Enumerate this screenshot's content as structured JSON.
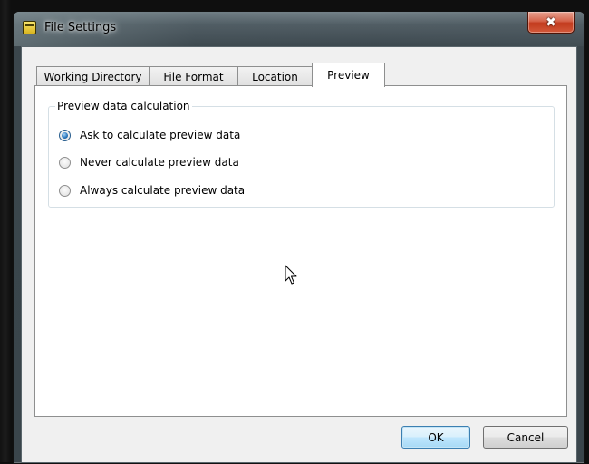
{
  "window": {
    "title": "File Settings",
    "close_glyph": "✖"
  },
  "tabs": [
    {
      "label": "Working Directory",
      "active": false
    },
    {
      "label": "File Format",
      "active": false
    },
    {
      "label": "Location",
      "active": false
    },
    {
      "label": "Preview",
      "active": true
    }
  ],
  "preview_group": {
    "legend": "Preview data calculation",
    "options": [
      {
        "label": "Ask to calculate preview data",
        "checked": true
      },
      {
        "label": "Never calculate preview data",
        "checked": false
      },
      {
        "label": "Always calculate preview data",
        "checked": false
      }
    ]
  },
  "buttons": {
    "ok_label": "OK",
    "cancel_label": "Cancel"
  },
  "colors": {
    "dialog_bg": "#f0f0f0",
    "panel_bg": "#ffffff",
    "selected_radio": "#2c79c0",
    "close_button": "#c23a1d"
  },
  "icons": {
    "app": "file-settings-app-icon",
    "close": "close-icon",
    "cursor": "mouse-pointer-icon"
  }
}
